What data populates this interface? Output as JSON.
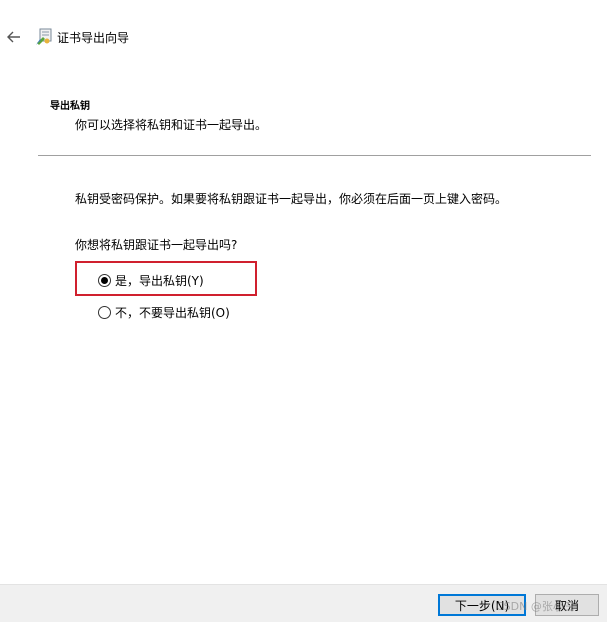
{
  "header": {
    "title": "证书导出向导"
  },
  "section": {
    "heading": "导出私钥",
    "subtitle": "你可以选择将私钥和证书一起导出。"
  },
  "body": {
    "info": "私钥受密码保护。如果要将私钥跟证书一起导出，你必须在后面一页上键入密码。",
    "question": "你想将私钥跟证书一起导出吗?",
    "options": [
      {
        "label": "是，导出私钥(Y)",
        "checked": true
      },
      {
        "label": "不，不要导出私钥(O)",
        "checked": false
      }
    ]
  },
  "footer": {
    "next_label": "下一步(N)",
    "cancel_label": "取消",
    "watermark": "CSDN @张小三"
  },
  "colors": {
    "highlight": "#d0202e",
    "focus": "#0078d7"
  }
}
